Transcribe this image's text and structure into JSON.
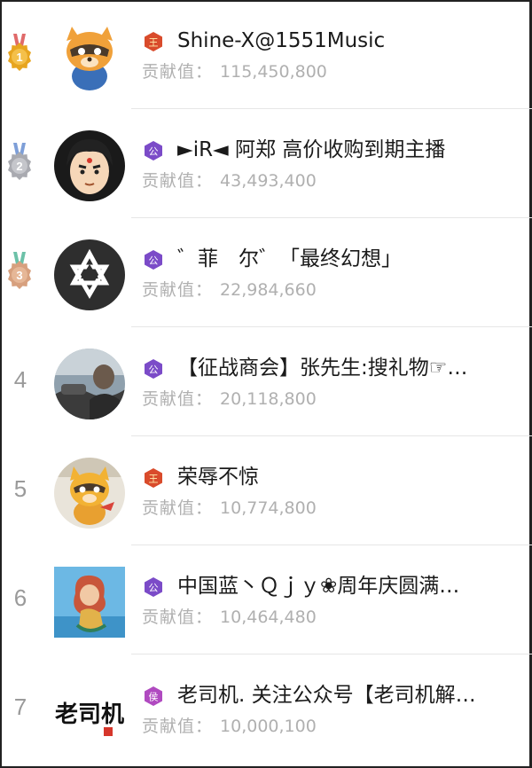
{
  "contribution_label": "贡献值：",
  "rows": [
    {
      "rank": "1",
      "badge": "王",
      "name": "Shine-X@1551Music",
      "value": "115,450,800"
    },
    {
      "rank": "2",
      "badge": "公",
      "name": "►iR◄ 阿郑 高价收购到期主播",
      "value": "43,493,400"
    },
    {
      "rank": "3",
      "badge": "公",
      "name": "゛菲　尔゛「最终幻想」",
      "value": "22,984,660"
    },
    {
      "rank": "4",
      "badge": "公",
      "name": "【征战商会】张先生:搜礼物☞…",
      "value": "20,118,800"
    },
    {
      "rank": "5",
      "badge": "王",
      "name": "荣辱不惊",
      "value": "10,774,800"
    },
    {
      "rank": "6",
      "badge": "公",
      "name": "中国蓝丶Ｑｊｙ❀周年庆圆满…",
      "value": "10,464,480"
    },
    {
      "rank": "7",
      "badge": "侯",
      "name": "老司机. 关注公众号【老司机解…",
      "value": "10,000,100"
    }
  ],
  "avatar_text": "老司机",
  "colors": {
    "badge_king": "#d94b2b",
    "badge_duke": "#7b4bc8",
    "badge_marquis": "#b04ac0",
    "medal_gold": "#e7a520",
    "medal_silver": "#a9aab0",
    "medal_bronze": "#d7a07e"
  }
}
